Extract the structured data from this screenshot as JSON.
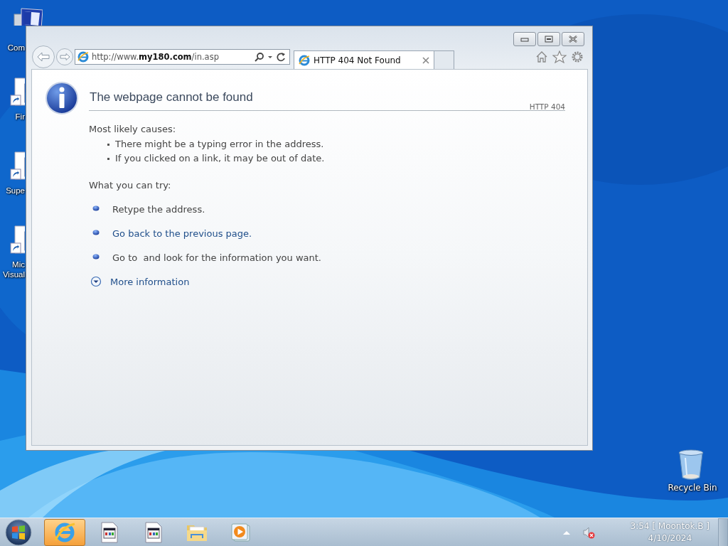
{
  "desktop": {
    "icons": [
      {
        "kind": "computer",
        "lines": [
          "Com"
        ]
      },
      {
        "kind": "shortcut",
        "lines": [
          "Fir"
        ]
      },
      {
        "kind": "shortcut",
        "lines": [
          "Supe"
        ]
      },
      {
        "kind": "shortcut",
        "lines": [
          "Mic",
          "Visual"
        ]
      },
      {
        "kind": "recycle",
        "lines": [
          "Recycle Bin"
        ]
      }
    ]
  },
  "browser": {
    "address": "http://www.**my180.com**/in.asp",
    "tabs": [
      {
        "title": "HTTP 404 Not Found",
        "selected": true
      }
    ],
    "page": {
      "title": "The webpage cannot be found",
      "code": "HTTP 404",
      "causes_heading": "Most likely causes:",
      "causes": [
        "There might be a typing error in the address.",
        "If you clicked on a link, it may be out of date."
      ],
      "try_heading": "What you can try:",
      "suggestions": [
        {
          "kind": "text",
          "text": "Retype the address."
        },
        {
          "kind": "link",
          "text": "Go back to the previous page."
        },
        {
          "kind": "text",
          "text": "Go to  and look for the information you want."
        }
      ],
      "more": "More information"
    }
  },
  "taskbar": {
    "items": [
      {
        "kind": "ie",
        "active": true
      },
      {
        "kind": "app",
        "active": false
      },
      {
        "kind": "app",
        "active": false
      },
      {
        "kind": "folder",
        "active": false
      },
      {
        "kind": "media",
        "active": false
      }
    ],
    "clock": {
      "time": "3:54 [ Moontok.B ]",
      "date": "4/10/2024"
    }
  }
}
